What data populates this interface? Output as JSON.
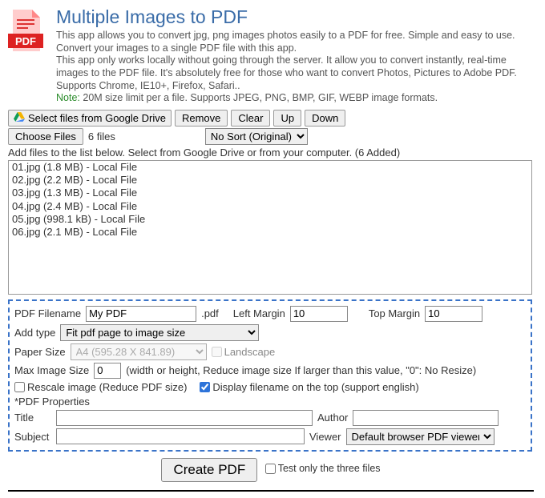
{
  "title": "Multiple Images to PDF",
  "desc1": "This app allows you to convert jpg, png images photos easily to a PDF for free. Simple and easy to use. Convert your images to a single PDF file with this app.",
  "desc2": "This app only works locally without going through the server. It allow you to convert instantly, real-time images to the PDF file. It's absolutely free for those who want to convert Photos, Pictures to Adobe PDF. Supports Chrome, IE10+, Firefox, Safari..",
  "note_label": "Note:",
  "note_text": " 20M size limit per a file. Supports JPEG, PNG, BMP, GIF, WEBP image formats.",
  "toolbar": {
    "gdrive": "Select files from Google Drive",
    "remove": "Remove",
    "clear": "Clear",
    "up": "Up",
    "down": "Down"
  },
  "choose_files": "Choose Files",
  "file_count": "6 files",
  "sort_selected": "No Sort (Original)",
  "instruction": "Add files to the list below. Select from Google Drive or from your computer. (6 Added)",
  "files": [
    "01.jpg (1.8 MB) - Local File",
    "02.jpg (2.2 MB) - Local File",
    "03.jpg (1.3 MB) - Local File",
    "04.jpg (2.4 MB) - Local File",
    "05.jpg (998.1 kB) - Local File",
    "06.jpg (2.1 MB) - Local File"
  ],
  "form": {
    "pdf_filename_label": "PDF Filename",
    "pdf_filename_value": "My PDF",
    "pdf_ext": ".pdf",
    "left_margin_label": "Left Margin",
    "left_margin_value": "10",
    "top_margin_label": "Top Margin",
    "top_margin_value": "10",
    "add_type_label": "Add type",
    "add_type_value": "Fit pdf page to image size",
    "paper_size_label": "Paper Size",
    "paper_size_value": "A4 (595.28 X 841.89)",
    "landscape_label": "Landscape",
    "max_img_label": "Max Image Size",
    "max_img_value": "0",
    "max_img_hint": "(width or height, Reduce image size If larger than this value, \"0\": No Resize)",
    "rescale_label": "Rescale image (Reduce PDF size)",
    "display_fn_label": "Display filename on the top (support english)",
    "props_heading": "*PDF Properties",
    "title_label": "Title",
    "author_label": "Author",
    "subject_label": "Subject",
    "viewer_label": "Viewer",
    "viewer_value": "Default browser PDF viewer"
  },
  "create_btn": "Create PDF",
  "test_label": "Test only the three files"
}
